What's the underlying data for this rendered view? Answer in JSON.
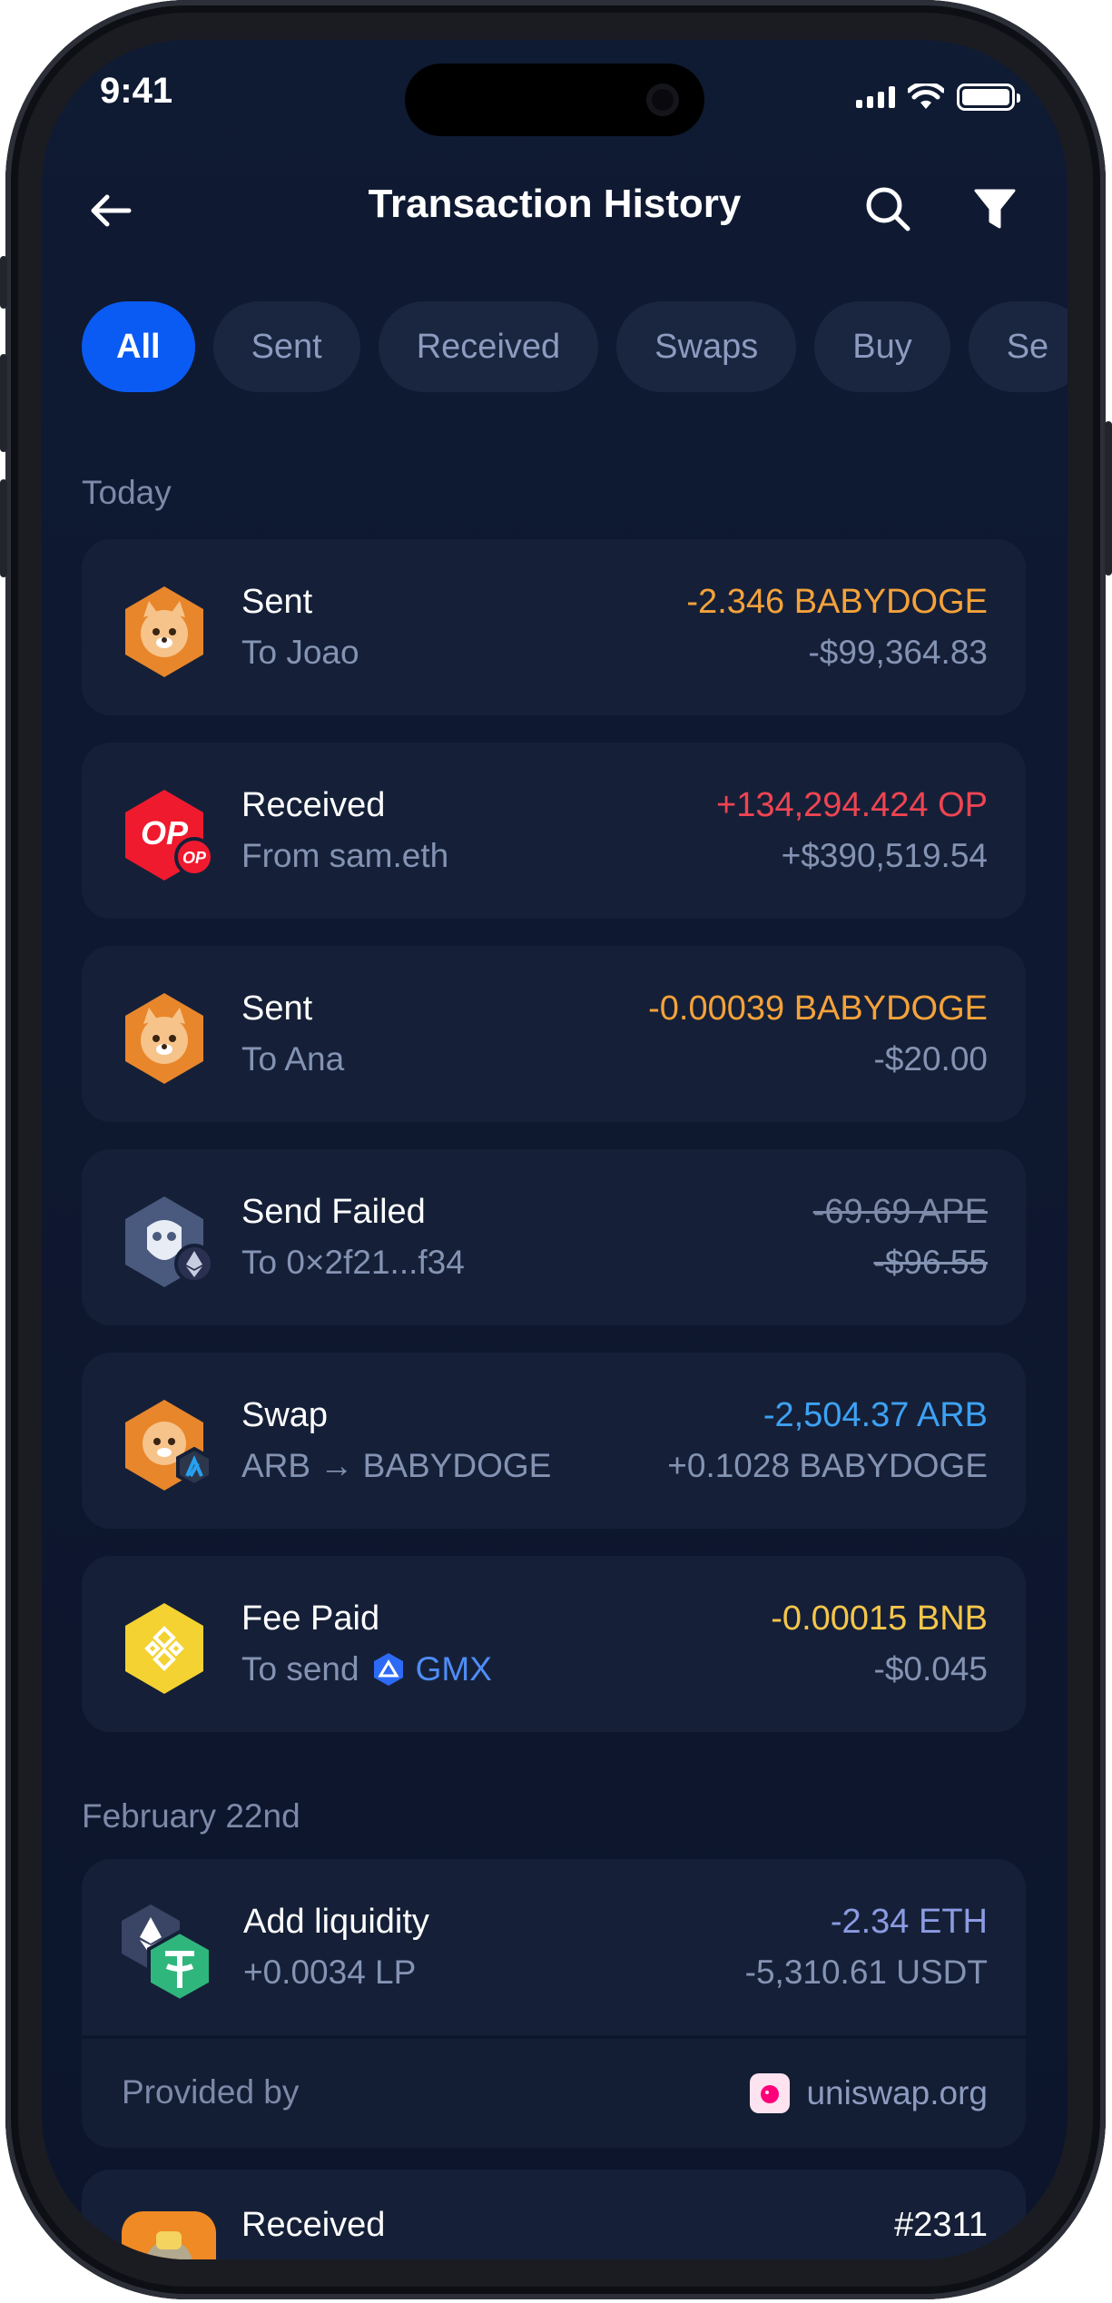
{
  "status_bar": {
    "time": "9:41"
  },
  "header": {
    "title": "Transaction History"
  },
  "filters": [
    {
      "label": "All",
      "active": true
    },
    {
      "label": "Sent",
      "active": false
    },
    {
      "label": "Received",
      "active": false
    },
    {
      "label": "Swaps",
      "active": false
    },
    {
      "label": "Buy",
      "active": false
    },
    {
      "label": "Se",
      "active": false
    }
  ],
  "sections": {
    "today": "Today",
    "feb": "February 22nd"
  },
  "transactions": [
    {
      "title": "Sent",
      "subtitle": "To Joao",
      "amount": "-2.346 BABYDOGE",
      "fiat": "-$99,364.83",
      "icon": "babydoge-icon"
    },
    {
      "title": "Received",
      "subtitle": "From sam.eth",
      "amount": "+134,294.424 OP",
      "fiat": "+$390,519.54",
      "icon": "optimism-icon"
    },
    {
      "title": "Sent",
      "subtitle": "To Ana",
      "amount": "-0.00039 BABYDOGE",
      "fiat": "-$20.00",
      "icon": "babydoge-icon"
    },
    {
      "title": "Send Failed",
      "subtitle": "To 0×2f21...f34",
      "amount": "-69.69 APE",
      "fiat": "-$96.55",
      "icon": "apecoin-icon"
    },
    {
      "title": "Swap",
      "subtitle": "ARB → BABYDOGE",
      "amount": "-2,504.37 ARB",
      "fiat": "+0.1028 BABYDOGE",
      "icon": "babydoge-arbitrum-icon"
    },
    {
      "title": "Fee Paid",
      "subtitle": "To send",
      "subtitle_token": "GMX",
      "amount": "-0.00015 BNB",
      "fiat": "-$0.045",
      "icon": "bnb-icon"
    }
  ],
  "liquidity": {
    "title": "Add liquidity",
    "subtitle": "+0.0034 LP",
    "amount": "-2.34 ETH",
    "fiat": "-5,310.61 USDT",
    "provided_label": "Provided by",
    "provider": "uniswap.org"
  },
  "last_tx": {
    "title": "Received",
    "value": "#2311"
  },
  "colors": {
    "accent": "#0a5bf3",
    "orange": "#f5a23a",
    "red": "#f04452",
    "green": "#35c47e"
  }
}
